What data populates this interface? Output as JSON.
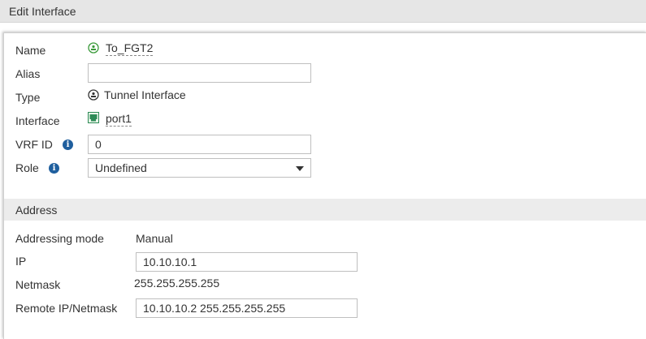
{
  "header": {
    "title": "Edit Interface"
  },
  "form": {
    "name": {
      "label": "Name",
      "value": "To_FGT2"
    },
    "alias": {
      "label": "Alias",
      "value": ""
    },
    "type": {
      "label": "Type",
      "value": "Tunnel Interface"
    },
    "interface": {
      "label": "Interface",
      "value": "port1"
    },
    "vrf_id": {
      "label": "VRF ID",
      "value": "0"
    },
    "role": {
      "label": "Role",
      "value": "Undefined"
    }
  },
  "address": {
    "section_title": "Address",
    "addressing_mode": {
      "label": "Addressing mode",
      "value": "Manual"
    },
    "ip": {
      "label": "IP",
      "value": "10.10.10.1"
    },
    "netmask": {
      "label": "Netmask",
      "value": "255.255.255.255"
    },
    "remote": {
      "label": "Remote IP/Netmask",
      "value": "10.10.10.2 255.255.255.255"
    }
  },
  "icons": {
    "tunnel": "tunnel-icon",
    "port": "ethernet-port-icon",
    "info": "info-icon"
  },
  "colors": {
    "info": "#1f5f9e",
    "tunnel_green": "#3a9a3a",
    "port_green": "#2e8b57"
  }
}
